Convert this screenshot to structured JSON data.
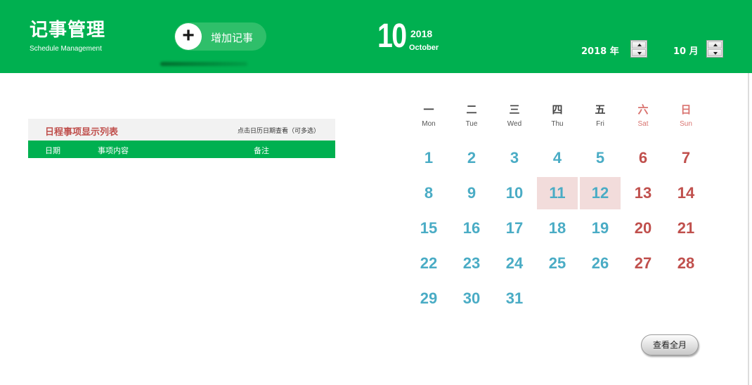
{
  "header": {
    "title": "记事管理",
    "subtitle": "Schedule Management",
    "add_button_label": "增加记事",
    "current_day": "10",
    "current_year": "2018",
    "current_month_name": "October",
    "year_select_label": "2018 年",
    "month_select_label": "10 月",
    "background_color": "#00b050"
  },
  "list": {
    "title": "日程事项显示列表",
    "hint": "点击日历日期查看（可多选）",
    "columns": [
      "日期",
      "事项内容",
      "备注"
    ]
  },
  "calendar": {
    "weekdays": [
      {
        "zh": "一",
        "en": "Mon",
        "weekend": false
      },
      {
        "zh": "二",
        "en": "Tue",
        "weekend": false
      },
      {
        "zh": "三",
        "en": "Wed",
        "weekend": false
      },
      {
        "zh": "四",
        "en": "Thu",
        "weekend": false
      },
      {
        "zh": "五",
        "en": "Fri",
        "weekend": false
      },
      {
        "zh": "六",
        "en": "Sat",
        "weekend": true
      },
      {
        "zh": "日",
        "en": "Sun",
        "weekend": true
      }
    ],
    "first_weekday_offset": 0,
    "days_in_month": 31,
    "marked_days": [
      11,
      12
    ],
    "weekday_color": "#4aacc5",
    "weekend_color": "#c0504d",
    "marked_color": "#f2dcdb"
  },
  "footer": {
    "view_month_button": "查看全月"
  }
}
